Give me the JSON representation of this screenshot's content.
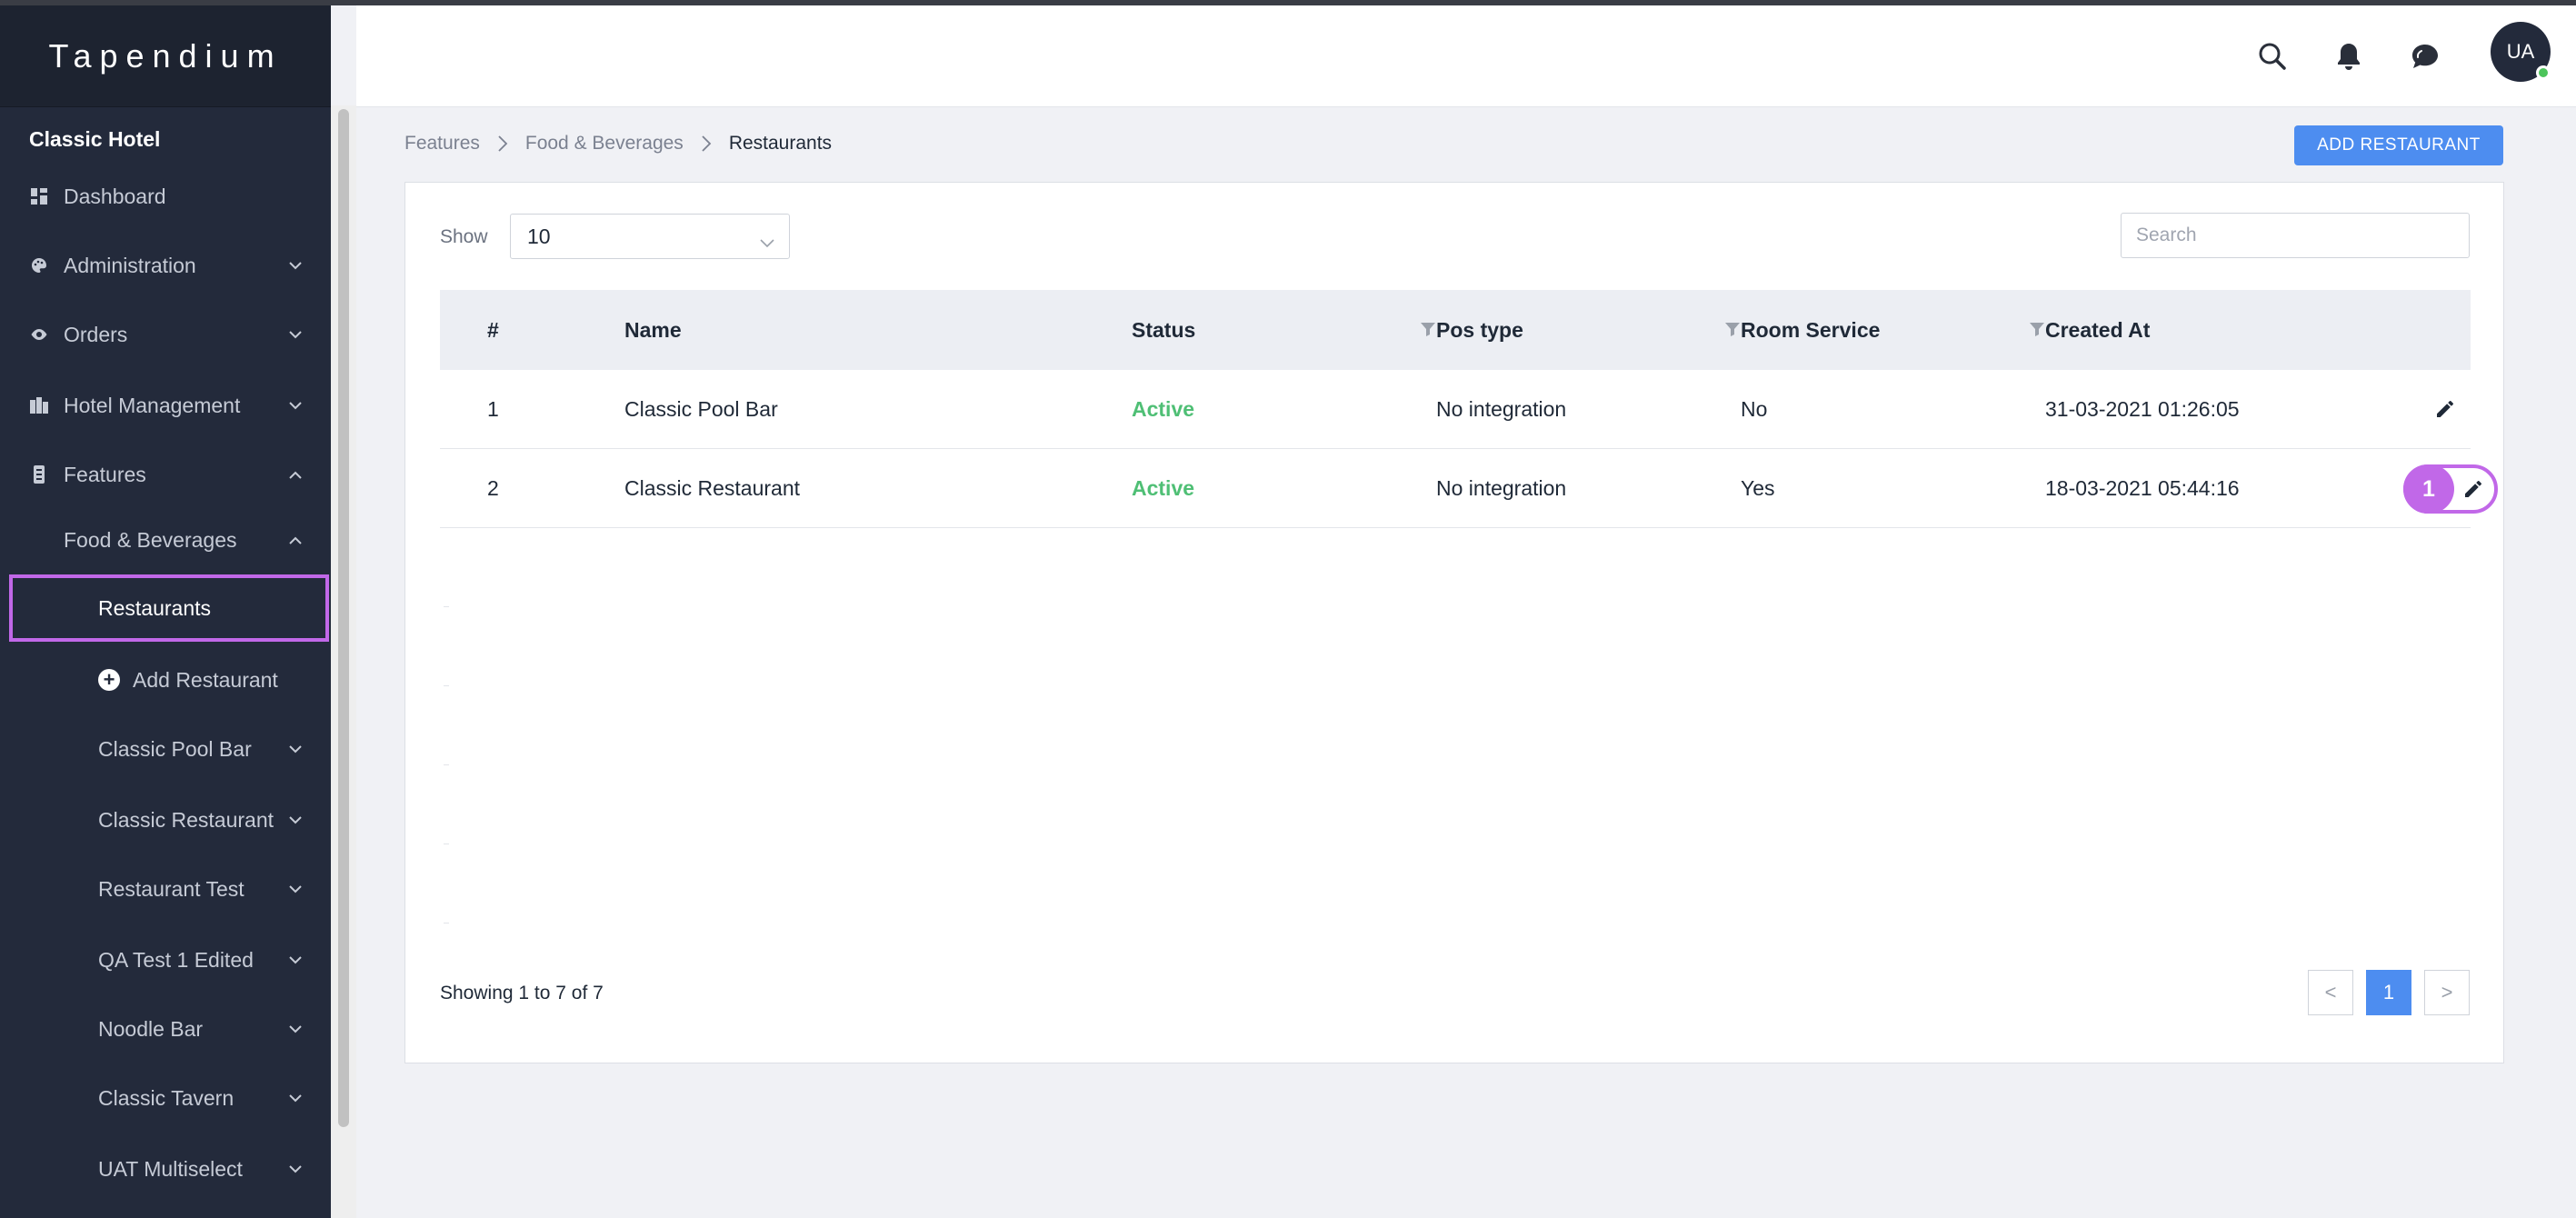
{
  "app": {
    "brand": "Tapendium",
    "hotel": "Classic Hotel",
    "avatar_initials": "UA"
  },
  "sidebar": {
    "items": [
      {
        "label": "Dashboard",
        "icon": "dashboard-icon"
      },
      {
        "label": "Administration",
        "icon": "palette-icon"
      },
      {
        "label": "Orders",
        "icon": "eye-icon"
      },
      {
        "label": "Hotel Management",
        "icon": "building-icon"
      },
      {
        "label": "Features",
        "icon": "features-icon"
      },
      {
        "label": "Food & Beverages"
      },
      {
        "label": "Restaurants"
      },
      {
        "label": "Add Restaurant",
        "icon": "plus-circle-icon"
      },
      {
        "label": "Classic Pool Bar"
      },
      {
        "label": "Classic Restaurant"
      },
      {
        "label": "Restaurant Test"
      },
      {
        "label": "QA Test 1 Edited"
      },
      {
        "label": "Noodle Bar"
      },
      {
        "label": "Classic Tavern"
      },
      {
        "label": "UAT Multiselect"
      }
    ]
  },
  "breadcrumb": {
    "items": [
      "Features",
      "Food & Beverages",
      "Restaurants"
    ]
  },
  "toolbar": {
    "add_label": "ADD RESTAURANT"
  },
  "table": {
    "show_label": "Show",
    "page_size": "10",
    "search_placeholder": "Search",
    "columns": [
      "#",
      "Name",
      "Status",
      "Pos type",
      "Room Service",
      "Created At"
    ],
    "rows": [
      {
        "num": "1",
        "name": "Classic Pool Bar",
        "status": "Active",
        "pos_type": "No integration",
        "room_service": "No",
        "created_at": "31-03-2021 01:26:05"
      },
      {
        "num": "2",
        "name": "Classic Restaurant",
        "status": "Active",
        "pos_type": "No integration",
        "room_service": "Yes",
        "created_at": "18-03-2021 05:44:16"
      }
    ],
    "annotation_badge": "1",
    "footer": "Showing 1 to 7 of 7",
    "pagination": {
      "prev": "<",
      "current": "1",
      "next": ">"
    }
  },
  "colors": {
    "sidebar_bg": "#232a3b",
    "accent": "#4d8df0",
    "highlight": "#c168e8",
    "active_status": "#4fbf75"
  }
}
